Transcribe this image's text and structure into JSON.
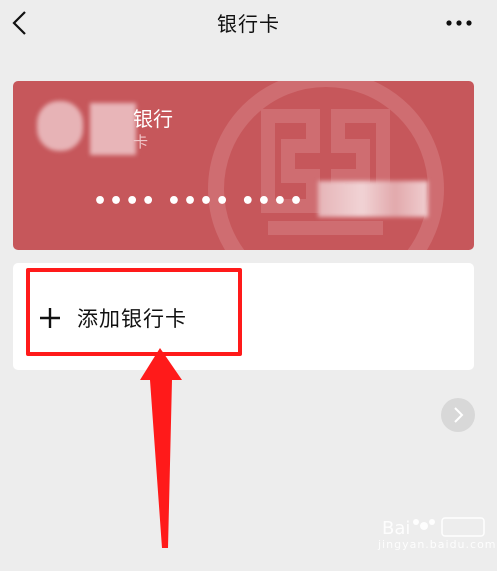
{
  "header": {
    "title": "银行卡"
  },
  "card": {
    "bank_name": "银行",
    "card_type": "卡",
    "masked_number": "•••• •••• ••••",
    "color": "#c6575b"
  },
  "add_card": {
    "label": "添加银行卡"
  },
  "watermark": {
    "text": "jingyan.baidu.com"
  },
  "colors": {
    "background": "#ededed",
    "highlight": "#ff1a1a"
  },
  "icons": [
    "back-arrow-icon",
    "more-dots-icon",
    "plus-icon",
    "chevron-right-icon",
    "baidu-paw-icon"
  ]
}
